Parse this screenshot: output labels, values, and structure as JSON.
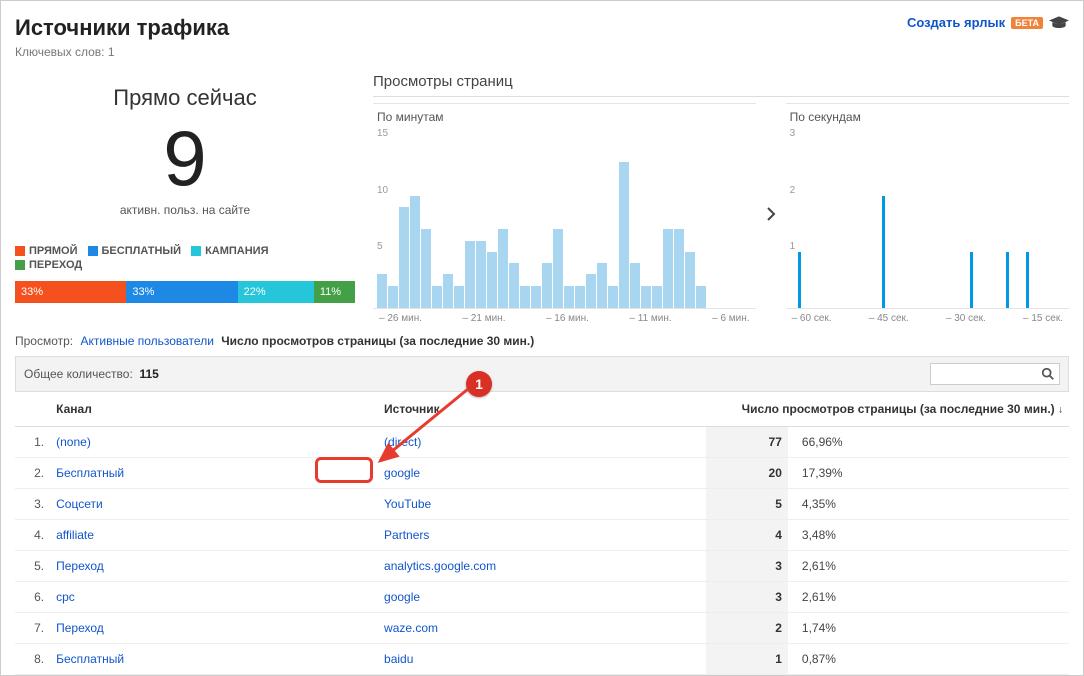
{
  "header": {
    "title": "Источники трафика",
    "subtitle_label": "Ключевых слов:",
    "subtitle_value": "1",
    "create_shortcut": "Создать ярлык",
    "beta": "БЕТА"
  },
  "right_now": {
    "title": "Прямо сейчас",
    "value": "9",
    "subtitle": "активн. польз. на сайте"
  },
  "legend": [
    {
      "label": "ПРЯМОЙ",
      "color": "#f4511e"
    },
    {
      "label": "БЕСПЛАТНЫЙ",
      "color": "#1e88e5"
    },
    {
      "label": "КАМПАНИЯ",
      "color": "#26c6da"
    },
    {
      "label": "ПЕРЕХОД",
      "color": "#43a047"
    }
  ],
  "distribution": [
    {
      "label": "33%",
      "color": "#f4511e",
      "flex": 33
    },
    {
      "label": "33%",
      "color": "#1e88e5",
      "flex": 33
    },
    {
      "label": "22%",
      "color": "#26c6da",
      "flex": 22
    },
    {
      "label": "11%",
      "color": "#43a047",
      "flex": 11
    }
  ],
  "pageviews": {
    "title": "Просмотры страниц",
    "per_minute_label": "По минутам",
    "per_second_label": "По секундам"
  },
  "chart_data": [
    {
      "type": "bar",
      "title": "По минутам",
      "ylim": [
        0,
        16
      ],
      "y_ticks": [
        5,
        10,
        15
      ],
      "x_labels": [
        "– 26 мин.",
        "– 21 мин.",
        "– 16 мин.",
        "– 11 мин.",
        "– 6 мин."
      ],
      "values": [
        3,
        2,
        9,
        10,
        7,
        2,
        3,
        2,
        6,
        6,
        5,
        7,
        4,
        2,
        2,
        4,
        7,
        2,
        2,
        3,
        4,
        2,
        13,
        4,
        2,
        2,
        7,
        7,
        5,
        2
      ]
    },
    {
      "type": "bar",
      "title": "По секундам",
      "ylim": [
        0,
        3.2
      ],
      "y_ticks": [
        1,
        2,
        3
      ],
      "x_labels": [
        "– 60 сек.",
        "– 45 сек.",
        "– 30 сек.",
        "– 15 сек."
      ],
      "values": [
        0,
        0,
        1,
        0,
        0,
        0,
        0,
        0,
        0,
        0,
        0,
        0,
        0,
        0,
        0,
        0,
        0,
        0,
        0,
        0,
        0,
        0,
        0,
        2,
        0,
        0,
        0,
        0,
        0,
        0,
        0,
        0,
        0,
        0,
        0,
        0,
        0,
        0,
        0,
        0,
        0,
        0,
        0,
        0,
        0,
        1,
        0,
        0,
        0,
        0,
        0,
        0,
        0,
        0,
        1,
        0,
        0,
        0,
        0,
        1
      ]
    }
  ],
  "filter": {
    "label": "Просмотр:",
    "option_active_users": "Активные пользователи",
    "option_pageviews": "Число просмотров страницы (за последние 30 мин.)"
  },
  "totals": {
    "label": "Общее количество:",
    "value": "115"
  },
  "table": {
    "cols": {
      "channel": "Канал",
      "source": "Источник",
      "pageviews": "Число просмотров страницы (за последние 30 мин.)"
    },
    "rows": [
      {
        "idx": "1.",
        "channel": "(none)",
        "source": "(direct)",
        "count": "77",
        "pct": "66,96%"
      },
      {
        "idx": "2.",
        "channel": "Бесплатный",
        "source": "google",
        "count": "20",
        "pct": "17,39%"
      },
      {
        "idx": "3.",
        "channel": "Соцсети",
        "source": "YouTube",
        "count": "5",
        "pct": "4,35%"
      },
      {
        "idx": "4.",
        "channel": "affiliate",
        "source": "Partners",
        "count": "4",
        "pct": "3,48%"
      },
      {
        "idx": "5.",
        "channel": "Переход",
        "source": "analytics.google.com",
        "count": "3",
        "pct": "2,61%"
      },
      {
        "idx": "6.",
        "channel": "cpc",
        "source": "google",
        "count": "3",
        "pct": "2,61%"
      },
      {
        "idx": "7.",
        "channel": "Переход",
        "source": "waze.com",
        "count": "2",
        "pct": "1,74%"
      },
      {
        "idx": "8.",
        "channel": "Бесплатный",
        "source": "baidu",
        "count": "1",
        "pct": "0,87%"
      }
    ]
  },
  "annotation": {
    "badge": "1"
  }
}
